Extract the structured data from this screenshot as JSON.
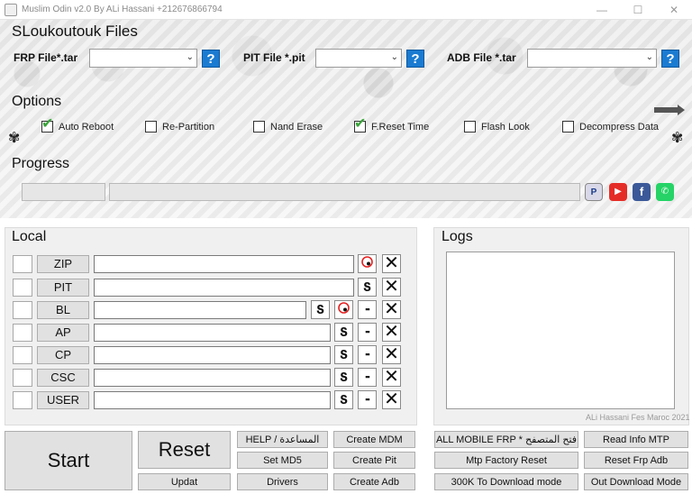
{
  "window": {
    "title": "Muslim Odin v2.0 By ALi Hassani +212676866794",
    "minimize": "—",
    "maximize": "☐",
    "close": "✕"
  },
  "header": {
    "title": "SLoukoutouk Files",
    "files": [
      {
        "label": "FRP File*.tar",
        "value": ""
      },
      {
        "label": "PIT File *.pit",
        "value": ""
      },
      {
        "label": "ADB File *.tar",
        "value": ""
      }
    ],
    "help_label": "?"
  },
  "options": {
    "title": "Options",
    "items": [
      {
        "label": "Auto Reboot",
        "checked": true
      },
      {
        "label": "Re-Partition",
        "checked": false
      },
      {
        "label": "Nand Erase",
        "checked": false
      },
      {
        "label": "F.Reset Time",
        "checked": true
      },
      {
        "label": "Flash Look",
        "checked": false
      },
      {
        "label": "Decompress Data",
        "checked": false
      }
    ]
  },
  "progress": {
    "title": "Progress",
    "percent": 0
  },
  "social": [
    {
      "name": "paypal-icon",
      "glyph": "P",
      "color": "#d8d8e8"
    },
    {
      "name": "youtube-icon",
      "glyph": "▶",
      "color": "#e52d27"
    },
    {
      "name": "facebook-icon",
      "glyph": "f",
      "color": "#3b5998"
    },
    {
      "name": "whatsapp-icon",
      "glyph": "✆",
      "color": "#25d366"
    }
  ],
  "local": {
    "title": "Local",
    "rows": [
      {
        "label": "ZIP",
        "value": ""
      },
      {
        "label": "PIT",
        "value": ""
      },
      {
        "label": "BL",
        "value": ""
      },
      {
        "label": "AP",
        "value": ""
      },
      {
        "label": "CP",
        "value": ""
      },
      {
        "label": "CSC",
        "value": ""
      },
      {
        "label": "USER",
        "value": ""
      }
    ]
  },
  "logs": {
    "title": "Logs",
    "content": "",
    "credit": "ALi Hassani Fes Maroc 2021"
  },
  "buttons": {
    "start": "Start",
    "reset": "Reset",
    "updat": "Updat",
    "help": "HELP / المساعدة",
    "set_md5": "Set MD5",
    "drivers": "Drivers",
    "create_mdm": "Create MDM",
    "create_pit": "Create Pit",
    "create_adb": "Create Adb",
    "all_mobile_frp": "ALL MOBILE FRP * فتح المتصفح",
    "mtp_factory_reset": "Mtp Factory Reset",
    "to_download_mode": "300K To Download mode",
    "read_info_mtp": "Read Info MTP",
    "reset_frp_adb": "Reset Frp Adb",
    "out_download_mode": "Out Download Mode"
  },
  "colors": {
    "help_blue": "#1a7bd1",
    "check_green": "#3aa43a"
  }
}
